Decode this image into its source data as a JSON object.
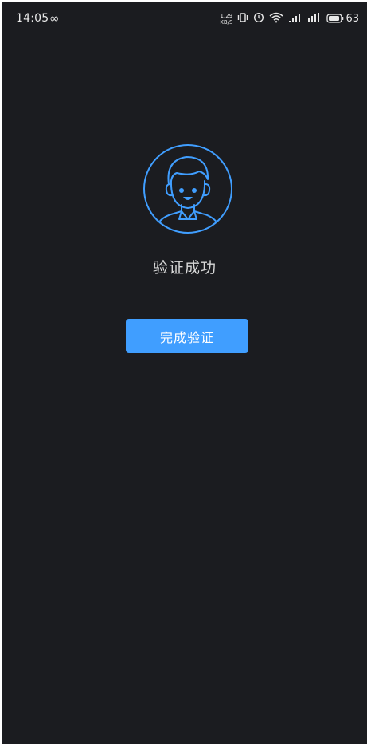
{
  "status_bar": {
    "time": "14:05",
    "infinity": "∞",
    "net_speed_value": "1.29",
    "net_speed_unit": "KB/S",
    "battery_level": "63"
  },
  "main": {
    "result_text": "验证成功",
    "done_button_label": "完成验证"
  },
  "colors": {
    "background": "#1b1c20",
    "accent": "#409eff",
    "text": "#d7d7d7"
  },
  "icons": {
    "avatar": "user-avatar-icon",
    "vibrate": "vibrate-icon",
    "alarm": "alarm-icon",
    "wifi": "wifi-icon",
    "signal": "signal-icon",
    "battery": "battery-icon"
  }
}
